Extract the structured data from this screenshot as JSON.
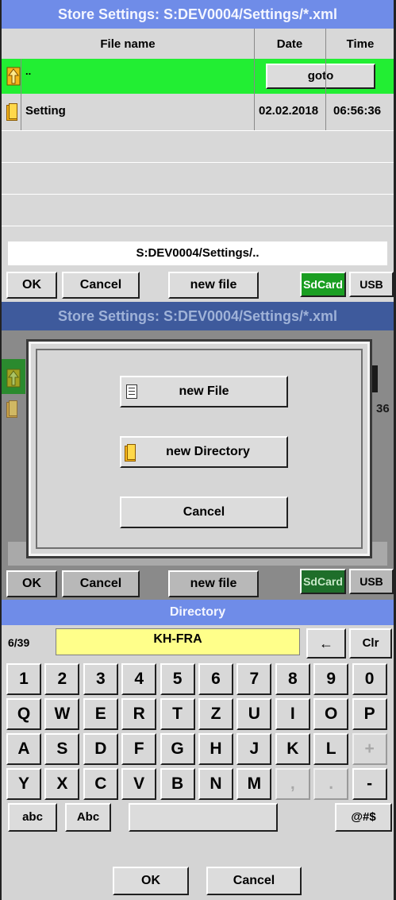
{
  "colors": {
    "title_bar": "#6f8ce8",
    "selected_row": "#22ee33",
    "sdcard_active": "#1a9e22",
    "input_bg": "#ffff8a"
  },
  "screen1": {
    "title": "Store Settings:  S:DEV0004/Settings/*.xml",
    "columns": {
      "file_name": "File name",
      "date": "Date",
      "time": "Time"
    },
    "rows": [
      {
        "icon": "up-arrow-icon",
        "name": "..",
        "action": "goto"
      },
      {
        "icon": "folder-icon",
        "name": "Setting",
        "date": "02.02.2018",
        "time": "06:56:36"
      }
    ],
    "path": "S:DEV0004/Settings/..",
    "buttons": {
      "ok": "OK",
      "cancel": "Cancel",
      "new_file": "new file",
      "sdcard": "SdCard",
      "usb": "USB"
    }
  },
  "screen2": {
    "title": "Store Settings:  S:DEV0004/Settings/*.xml",
    "partial_time": "36",
    "dialog": {
      "new_file": "new File",
      "new_directory": "new Directory",
      "cancel": "Cancel"
    },
    "buttons": {
      "ok": "OK",
      "cancel": "Cancel",
      "new_file": "new file",
      "sdcard": "SdCard",
      "usb": "USB"
    }
  },
  "screen3": {
    "title": "Directory",
    "counter": "6/39",
    "value": "KH-FRA",
    "backspace": "←",
    "clear": "Clr",
    "keys": {
      "row1": [
        "1",
        "2",
        "3",
        "4",
        "5",
        "6",
        "7",
        "8",
        "9",
        "0"
      ],
      "row2": [
        "Q",
        "W",
        "E",
        "R",
        "T",
        "Z",
        "U",
        "I",
        "O",
        "P"
      ],
      "row3": [
        "A",
        "S",
        "D",
        "F",
        "G",
        "H",
        "J",
        "K",
        "L",
        "+"
      ],
      "row4": [
        "Y",
        "X",
        "C",
        "V",
        "B",
        "N",
        "M",
        ",",
        ".",
        "-"
      ]
    },
    "mode_lower": "abc",
    "mode_shift": "Abc",
    "mode_symbols": "@#$",
    "ok": "OK",
    "cancel": "Cancel"
  }
}
